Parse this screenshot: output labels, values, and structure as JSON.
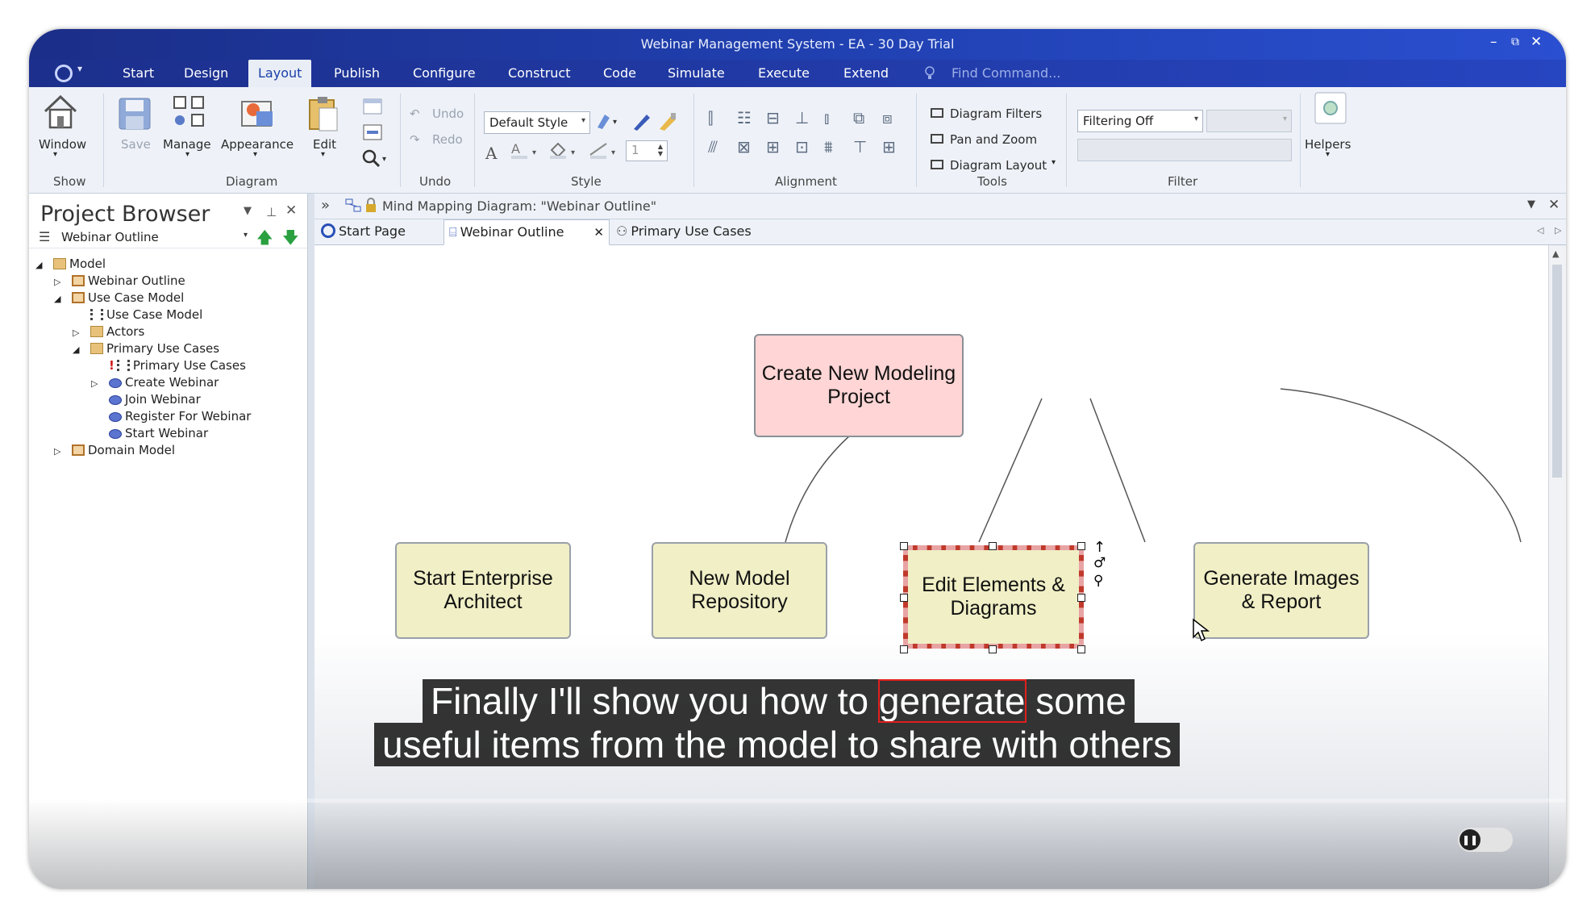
{
  "window": {
    "title": "Webinar Management System - EA - 30 Day Trial",
    "controls": {
      "minimize": "–",
      "restore": "⧉",
      "close": "✕"
    }
  },
  "menu": {
    "tabs": [
      "Start",
      "Design",
      "Layout",
      "Publish",
      "Configure",
      "Construct",
      "Code",
      "Simulate",
      "Execute",
      "Extend"
    ],
    "active_tab": "Layout",
    "find_command": "Find Command..."
  },
  "ribbon": {
    "show": {
      "window_label": "Window",
      "group": "Show"
    },
    "diagram": {
      "save_label": "Save",
      "manage_label": "Manage",
      "appearance_label": "Appearance",
      "edit_label": "Edit",
      "group": "Diagram"
    },
    "undo": {
      "undo_label": "Undo",
      "redo_label": "Redo",
      "group": "Undo"
    },
    "style": {
      "style_combo": "Default Style",
      "line_width": "1",
      "group": "Style"
    },
    "alignment": {
      "group": "Alignment"
    },
    "tools": {
      "diagram_filters": "Diagram Filters",
      "pan_zoom": "Pan and Zoom",
      "diagram_layout": "Diagram Layout",
      "group": "Tools"
    },
    "filter": {
      "filter_combo": "Filtering Off",
      "group": "Filter"
    },
    "helpers": {
      "label": "Helpers"
    }
  },
  "project_browser": {
    "title": "Project Browser",
    "current_package": "Webinar Outline",
    "tree": [
      {
        "label": "Model",
        "toggle": "◢"
      },
      {
        "label": "Webinar Outline",
        "toggle": "▷"
      },
      {
        "label": "Use Case Model",
        "toggle": "◢"
      },
      {
        "label": "Use Case Model",
        "toggle": ""
      },
      {
        "label": "Actors",
        "toggle": "▷"
      },
      {
        "label": "Primary Use Cases",
        "toggle": "◢"
      },
      {
        "label": "Primary Use Cases",
        "toggle": "",
        "marker": "!"
      },
      {
        "label": "Create Webinar",
        "toggle": "▷"
      },
      {
        "label": "Join Webinar",
        "toggle": ""
      },
      {
        "label": "Register For Webinar",
        "toggle": ""
      },
      {
        "label": "Start Webinar",
        "toggle": ""
      },
      {
        "label": "Domain Model",
        "toggle": "▷"
      }
    ]
  },
  "document": {
    "header": "Mind Mapping Diagram: \"Webinar Outline\"",
    "tabs": [
      "Start Page",
      "Webinar Outline",
      "Primary Use Cases"
    ],
    "active_tab": "Webinar Outline"
  },
  "diagram": {
    "root": "Create New Modeling Project",
    "children": [
      "Start Enterprise Architect",
      "New Model Repository",
      "Edit Elements & Diagrams",
      "Generate Images & Report"
    ],
    "selected": "Edit Elements & Diagrams",
    "colors": {
      "root_fill": "#ffd5d5",
      "leaf_fill": "#f0efc6",
      "selection": "#c0392b"
    }
  },
  "subtitle": {
    "line1_before": "Finally I'll show you how to ",
    "line1_highlight": "generate",
    "line1_after": " some",
    "line2": "useful items from the model to share with others"
  }
}
